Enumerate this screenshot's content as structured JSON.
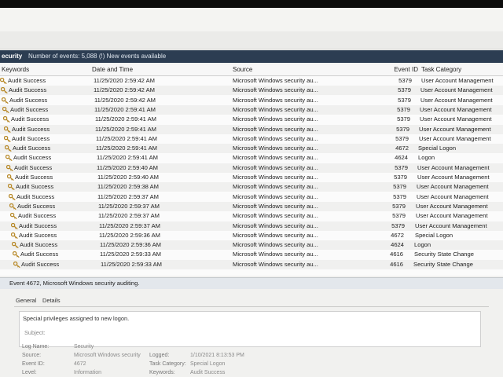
{
  "titlebar": {
    "log_name": "ecurity",
    "event_count": "Number of events: 5,088 (!) New events available"
  },
  "columns": {
    "keywords": "Keywords",
    "date_time": "Date and Time",
    "source": "Source",
    "event_id": "Event ID",
    "task_category": "Task Category"
  },
  "events": [
    {
      "keywords": "Audit Success",
      "date_time": "11/25/2020 2:59:42 AM",
      "source": "Microsoft Windows security au...",
      "event_id": "5379",
      "task_category": "User Account Management"
    },
    {
      "keywords": "Audit Success",
      "date_time": "11/25/2020 2:59:42 AM",
      "source": "Microsoft Windows security au...",
      "event_id": "5379",
      "task_category": "User Account Management"
    },
    {
      "keywords": "Audit Success",
      "date_time": "11/25/2020 2:59:42 AM",
      "source": "Microsoft Windows security au...",
      "event_id": "5379",
      "task_category": "User Account Management"
    },
    {
      "keywords": "Audit Success",
      "date_time": "11/25/2020 2:59:41 AM",
      "source": "Microsoft Windows security au...",
      "event_id": "5379",
      "task_category": "User Account Management"
    },
    {
      "keywords": "Audit Success",
      "date_time": "11/25/2020 2:59:41 AM",
      "source": "Microsoft Windows security au...",
      "event_id": "5379",
      "task_category": "User Account Management"
    },
    {
      "keywords": "Audit Success",
      "date_time": "11/25/2020 2:59:41 AM",
      "source": "Microsoft Windows security au...",
      "event_id": "5379",
      "task_category": "User Account Management"
    },
    {
      "keywords": "Audit Success",
      "date_time": "11/25/2020 2:59:41 AM",
      "source": "Microsoft Windows security au...",
      "event_id": "5379",
      "task_category": "User Account Management"
    },
    {
      "keywords": "Audit Success",
      "date_time": "11/25/2020 2:59:41 AM",
      "source": "Microsoft Windows security au...",
      "event_id": "4672",
      "task_category": "Special Logon"
    },
    {
      "keywords": "Audit Success",
      "date_time": "11/25/2020 2:59:41 AM",
      "source": "Microsoft Windows security au...",
      "event_id": "4624",
      "task_category": "Logon"
    },
    {
      "keywords": "Audit Success",
      "date_time": "11/25/2020 2:59:40 AM",
      "source": "Microsoft Windows security au...",
      "event_id": "5379",
      "task_category": "User Account Management"
    },
    {
      "keywords": "Audit Success",
      "date_time": "11/25/2020 2:59:40 AM",
      "source": "Microsoft Windows security au...",
      "event_id": "5379",
      "task_category": "User Account Management"
    },
    {
      "keywords": "Audit Success",
      "date_time": "11/25/2020 2:59:38 AM",
      "source": "Microsoft Windows security au...",
      "event_id": "5379",
      "task_category": "User Account Management"
    },
    {
      "keywords": "Audit Success",
      "date_time": "11/25/2020 2:59:37 AM",
      "source": "Microsoft Windows security au...",
      "event_id": "5379",
      "task_category": "User Account Management"
    },
    {
      "keywords": "Audit Success",
      "date_time": "11/25/2020 2:59:37 AM",
      "source": "Microsoft Windows security au...",
      "event_id": "5379",
      "task_category": "User Account Management"
    },
    {
      "keywords": "Audit Success",
      "date_time": "11/25/2020 2:59:37 AM",
      "source": "Microsoft Windows security au...",
      "event_id": "5379",
      "task_category": "User Account Management"
    },
    {
      "keywords": "Audit Success",
      "date_time": "11/25/2020 2:59:37 AM",
      "source": "Microsoft Windows security au...",
      "event_id": "5379",
      "task_category": "User Account Management"
    },
    {
      "keywords": "Audit Success",
      "date_time": "11/25/2020 2:59:36 AM",
      "source": "Microsoft Windows security au...",
      "event_id": "4672",
      "task_category": "Special Logon"
    },
    {
      "keywords": "Audit Success",
      "date_time": "11/25/2020 2:59:36 AM",
      "source": "Microsoft Windows security au...",
      "event_id": "4624",
      "task_category": "Logon"
    },
    {
      "keywords": "Audit Success",
      "date_time": "11/25/2020 2:59:33 AM",
      "source": "Microsoft Windows security au...",
      "event_id": "4616",
      "task_category": "Security State Change"
    },
    {
      "keywords": "Audit Success",
      "date_time": "11/25/2020 2:59:33 AM",
      "source": "Microsoft Windows security au...",
      "event_id": "4616",
      "task_category": "Security State Change"
    }
  ],
  "selected_event": {
    "header": "Event 4672, Microsoft Windows security auditing.",
    "tabs": {
      "general": "General",
      "details": "Details"
    },
    "message": "Special privileges assigned to new logon.",
    "subject": "Subject:",
    "fields": {
      "log_name_label": "Log Name:",
      "log_name_value": "Security",
      "source_label": "Source:",
      "source_value": "Microsoft Windows security",
      "event_id_label": "Event ID:",
      "event_id_value": "4672",
      "level_label": "Level:",
      "level_value": "Information",
      "logged_label": "Logged:",
      "logged_value": "1/10/2021 8:13:53 PM",
      "task_category_label": "Task Category:",
      "task_category_value": "Special Logon",
      "keywords_label": "Keywords:",
      "keywords_value": "Audit Success"
    }
  },
  "colors": {
    "titlebar": "#2c3d52",
    "key_icon": "#b88a2a"
  },
  "icons": {
    "keyword": "key-icon"
  }
}
